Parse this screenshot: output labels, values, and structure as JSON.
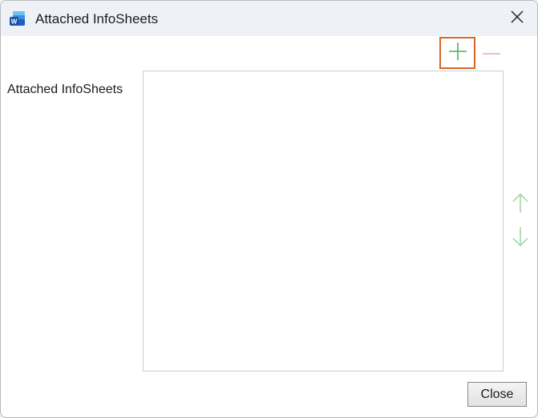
{
  "window": {
    "title": "Attached InfoSheets",
    "app_icon": "word-icon",
    "close_icon": "close-icon"
  },
  "content": {
    "label": "Attached InfoSheets",
    "list_items": []
  },
  "toolbar": {
    "add_icon": "plus-icon",
    "remove_icon": "minus-icon",
    "move_up_icon": "arrow-up-icon",
    "move_down_icon": "arrow-down-icon"
  },
  "footer": {
    "close_label": "Close"
  },
  "colors": {
    "accent_green": "#4fae5a",
    "muted_green": "#9bd3a2",
    "muted_red": "#f0a5a5",
    "highlight_border": "#d8652a"
  }
}
